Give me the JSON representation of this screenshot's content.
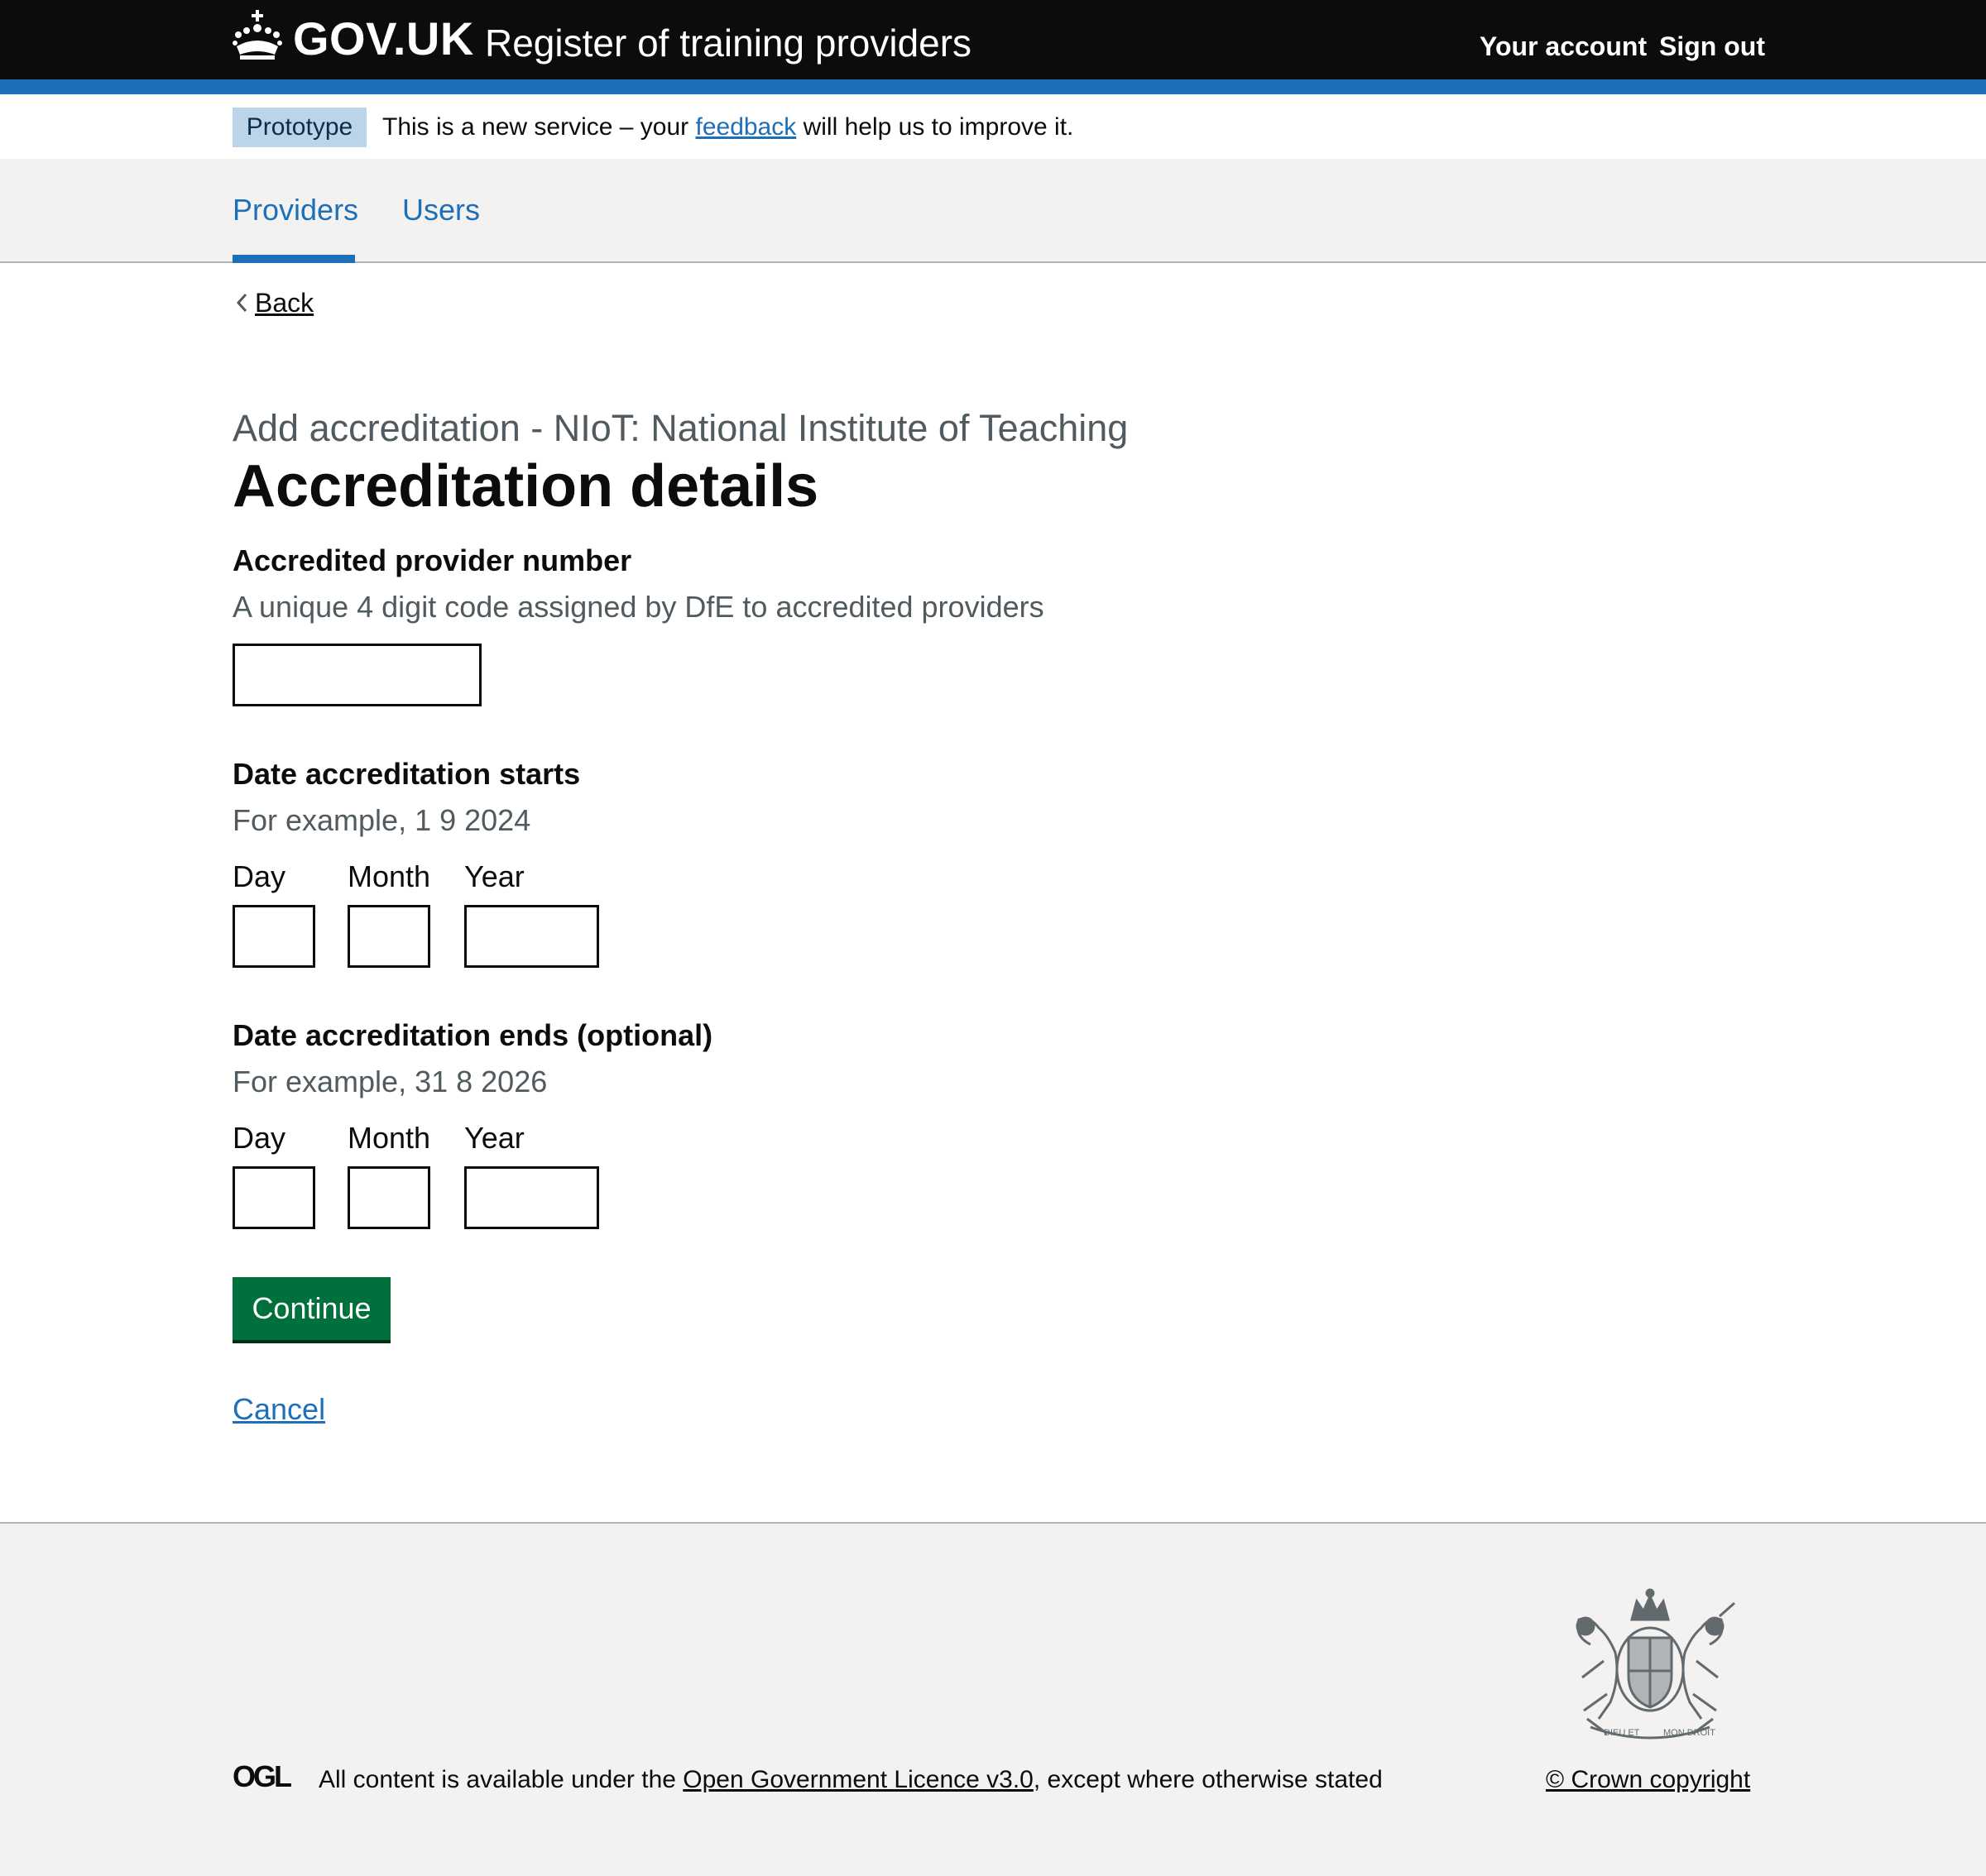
{
  "header": {
    "logo_text": "GOV.UK",
    "service_name": "Register of training providers",
    "links": {
      "your_account": "Your account",
      "sign_out": "Sign out"
    }
  },
  "phase_banner": {
    "tag": "Prototype",
    "text_before": "This is a new service – your ",
    "link_text": "feedback",
    "text_after": " will help us to improve it."
  },
  "nav": {
    "items": [
      {
        "label": "Providers",
        "active": true
      },
      {
        "label": "Users",
        "active": false
      }
    ]
  },
  "back_link": "Back",
  "page": {
    "caption": "Add accreditation - NIoT: National Institute of Teaching",
    "title": "Accreditation details"
  },
  "form": {
    "provider_number": {
      "label": "Accredited provider number",
      "hint": "A unique 4 digit code assigned by DfE to accredited providers",
      "value": ""
    },
    "start_date": {
      "legend": "Date accreditation starts",
      "hint": "For example, 1 9 2024",
      "day_label": "Day",
      "month_label": "Month",
      "year_label": "Year",
      "day": "",
      "month": "",
      "year": ""
    },
    "end_date": {
      "legend": "Date accreditation ends (optional)",
      "hint": "For example, 31 8 2026",
      "day_label": "Day",
      "month_label": "Month",
      "year_label": "Year",
      "day": "",
      "month": "",
      "year": ""
    },
    "continue_label": "Continue",
    "cancel_label": "Cancel"
  },
  "footer": {
    "ogl_logo": "OGL",
    "licence_before": "All content is available under the ",
    "licence_link": "Open Government Licence v3.0",
    "licence_after": ", except where otherwise stated",
    "copyright": "© Crown copyright",
    "crest_text_left": "DIEU ET",
    "crest_text_right": "MON DROIT"
  },
  "colors": {
    "header_bg": "#0b0c0c",
    "brand_blue": "#1d70b8",
    "button_green": "#00703c",
    "footer_bg": "#f3f2f1",
    "secondary_text": "#505a5f"
  }
}
